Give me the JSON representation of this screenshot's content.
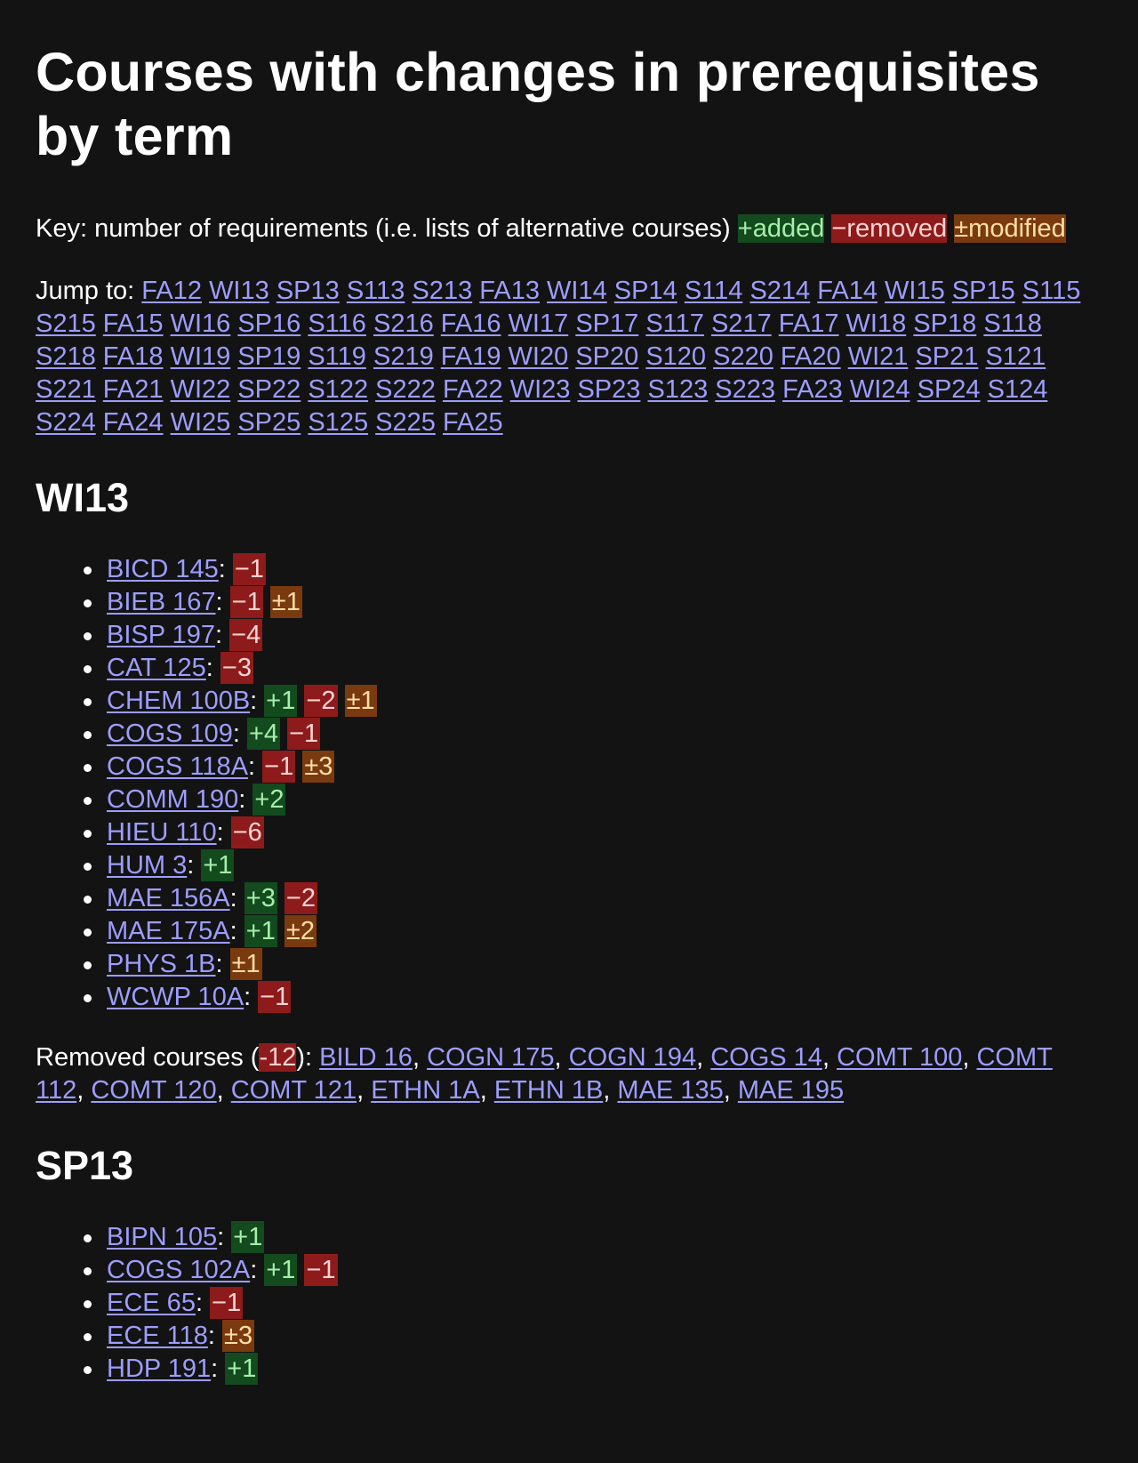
{
  "title": "Courses with changes in prerequisites by term",
  "key": {
    "text": "Key: number of requirements (i.e. lists of alternative courses)",
    "added": "+added",
    "removed": "−removed",
    "modified": "±modified"
  },
  "jump": {
    "label": "Jump to:",
    "terms": [
      "FA12",
      "WI13",
      "SP13",
      "S113",
      "S213",
      "FA13",
      "WI14",
      "SP14",
      "S114",
      "S214",
      "FA14",
      "WI15",
      "SP15",
      "S115",
      "S215",
      "FA15",
      "WI16",
      "SP16",
      "S116",
      "S216",
      "FA16",
      "WI17",
      "SP17",
      "S117",
      "S217",
      "FA17",
      "WI18",
      "SP18",
      "S118",
      "S218",
      "FA18",
      "WI19",
      "SP19",
      "S119",
      "S219",
      "FA19",
      "WI20",
      "SP20",
      "S120",
      "S220",
      "FA20",
      "WI21",
      "SP21",
      "S121",
      "S221",
      "FA21",
      "WI22",
      "SP22",
      "S122",
      "S222",
      "FA22",
      "WI23",
      "SP23",
      "S123",
      "S223",
      "FA23",
      "WI24",
      "SP24",
      "S124",
      "S224",
      "FA24",
      "WI25",
      "SP25",
      "S125",
      "S225",
      "FA25"
    ]
  },
  "sections": [
    {
      "term": "WI13",
      "courses": [
        {
          "name": "BICD 145",
          "changes": [
            {
              "kind": "rem",
              "text": "−1"
            }
          ]
        },
        {
          "name": "BIEB 167",
          "changes": [
            {
              "kind": "rem",
              "text": "−1"
            },
            {
              "kind": "mod",
              "text": "±1"
            }
          ]
        },
        {
          "name": "BISP 197",
          "changes": [
            {
              "kind": "rem",
              "text": "−4"
            }
          ]
        },
        {
          "name": "CAT 125",
          "changes": [
            {
              "kind": "rem",
              "text": "−3"
            }
          ]
        },
        {
          "name": "CHEM 100B",
          "changes": [
            {
              "kind": "add",
              "text": "+1"
            },
            {
              "kind": "rem",
              "text": "−2"
            },
            {
              "kind": "mod",
              "text": "±1"
            }
          ]
        },
        {
          "name": "COGS 109",
          "changes": [
            {
              "kind": "add",
              "text": "+4"
            },
            {
              "kind": "rem",
              "text": "−1"
            }
          ]
        },
        {
          "name": "COGS 118A",
          "changes": [
            {
              "kind": "rem",
              "text": "−1"
            },
            {
              "kind": "mod",
              "text": "±3"
            }
          ]
        },
        {
          "name": "COMM 190",
          "changes": [
            {
              "kind": "add",
              "text": "+2"
            }
          ]
        },
        {
          "name": "HIEU 110",
          "changes": [
            {
              "kind": "rem",
              "text": "−6"
            }
          ]
        },
        {
          "name": "HUM 3",
          "changes": [
            {
              "kind": "add",
              "text": "+1"
            }
          ]
        },
        {
          "name": "MAE 156A",
          "changes": [
            {
              "kind": "add",
              "text": "+3"
            },
            {
              "kind": "rem",
              "text": "−2"
            }
          ]
        },
        {
          "name": "MAE 175A",
          "changes": [
            {
              "kind": "add",
              "text": "+1"
            },
            {
              "kind": "mod",
              "text": "±2"
            }
          ]
        },
        {
          "name": "PHYS 1B",
          "changes": [
            {
              "kind": "mod",
              "text": "±1"
            }
          ]
        },
        {
          "name": "WCWP 10A",
          "changes": [
            {
              "kind": "rem",
              "text": "−1"
            }
          ]
        }
      ],
      "removed": {
        "label": "Removed courses (",
        "count": "-12",
        "label_end": "):",
        "courses": [
          "BILD 16",
          "COGN 175",
          "COGN 194",
          "COGS 14",
          "COMT 100",
          "COMT 112",
          "COMT 120",
          "COMT 121",
          "ETHN 1A",
          "ETHN 1B",
          "MAE 135",
          "MAE 195"
        ]
      }
    },
    {
      "term": "SP13",
      "courses": [
        {
          "name": "BIPN 105",
          "changes": [
            {
              "kind": "add",
              "text": "+1"
            }
          ]
        },
        {
          "name": "COGS 102A",
          "changes": [
            {
              "kind": "add",
              "text": "+1"
            },
            {
              "kind": "rem",
              "text": "−1"
            }
          ]
        },
        {
          "name": "ECE 65",
          "changes": [
            {
              "kind": "rem",
              "text": "−1"
            }
          ]
        },
        {
          "name": "ECE 118",
          "changes": [
            {
              "kind": "mod",
              "text": "±3"
            }
          ]
        },
        {
          "name": "HDP 191",
          "changes": [
            {
              "kind": "add",
              "text": "+1"
            }
          ]
        }
      ]
    }
  ]
}
